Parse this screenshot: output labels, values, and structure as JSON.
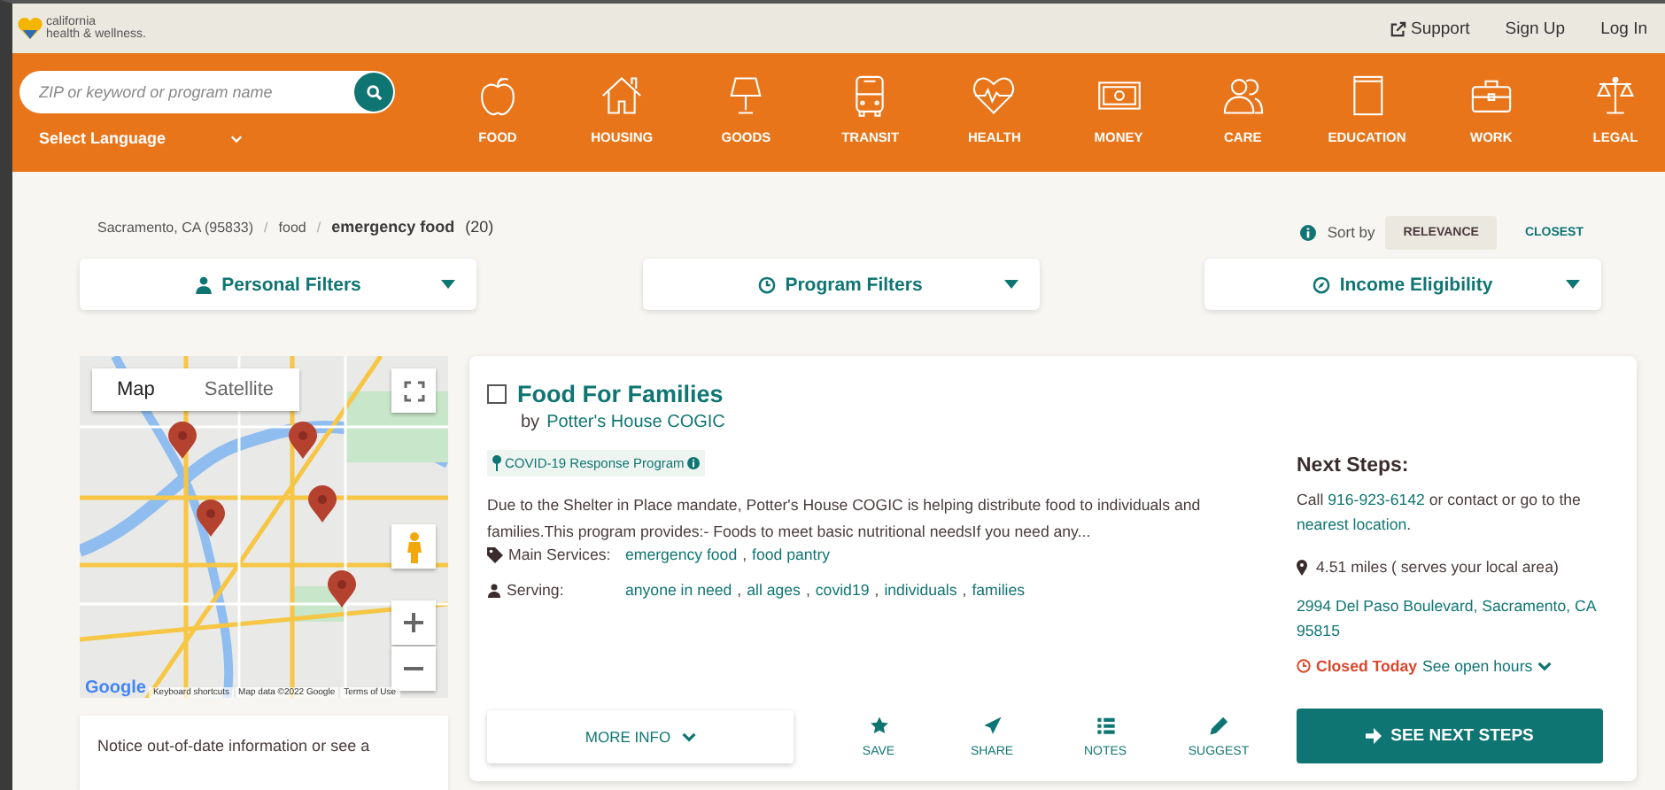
{
  "header": {
    "logo": {
      "line_1": "california",
      "line_2": "health & wellness."
    },
    "links": [
      {
        "label": "Support",
        "kind": "external"
      },
      {
        "label": "Sign Up",
        "kind": "plain"
      },
      {
        "label": "Log In",
        "kind": "plain"
      }
    ]
  },
  "search": {
    "placeholder": "ZIP or keyword or program name",
    "language": "Select Language"
  },
  "categories": [
    {
      "label": "FOOD",
      "kind": "food"
    },
    {
      "label": "HOUSING",
      "kind": "housing"
    },
    {
      "label": "GOODS",
      "kind": "goods"
    },
    {
      "label": "TRANSIT",
      "kind": "transit"
    },
    {
      "label": "HEALTH",
      "kind": "health"
    },
    {
      "label": "MONEY",
      "kind": "money"
    },
    {
      "label": "CARE",
      "kind": "care"
    },
    {
      "label": "EDUCATION",
      "kind": "education"
    },
    {
      "label": "WORK",
      "kind": "work"
    },
    {
      "label": "LEGAL",
      "kind": "legal"
    }
  ],
  "breadcrumb": {
    "separator": "/",
    "items": [
      "Sacramento, CA (95833)",
      "food"
    ],
    "current": "emergency food",
    "count": "(20)"
  },
  "sort": {
    "label": "Sort by",
    "options": [
      {
        "label": "RELEVANCE",
        "selected": true
      },
      {
        "label": "CLOSEST",
        "selected": false
      }
    ]
  },
  "filters": [
    {
      "label": "Personal Filters",
      "kind": "person"
    },
    {
      "label": "Program Filters",
      "kind": "clock"
    },
    {
      "label": "Income Eligibility",
      "kind": "compass"
    }
  ],
  "map": {
    "types": [
      {
        "label": "Map",
        "selected": true
      },
      {
        "label": "Satellite",
        "selected": false
      }
    ],
    "logo": "Google",
    "attribution": [
      "Keyboard shortcuts",
      "Map data ©2022 Google",
      "Terms of Use"
    ]
  },
  "notice": "Notice out-of-date information or see a",
  "program": {
    "checked": false,
    "title": "Food For Families",
    "by": "by",
    "provider": "Potter's House COGIC",
    "tag": "COVID-19 Response Program",
    "description": "Due to the Shelter in Place mandate, Potter's House COGIC is helping distribute food to individuals and families.This program provides:- Foods to meet basic nutritional needsIf you need any...",
    "separator": ",",
    "main_services_label": "Main Services:",
    "main_services": [
      "emergency food",
      "food pantry"
    ],
    "serving_label": "Serving:",
    "serving": [
      "anyone in need",
      "all ages",
      "covid19",
      "individuals",
      "families"
    ],
    "more_info": "MORE INFO",
    "actions": [
      {
        "label": "SAVE",
        "kind": "star"
      },
      {
        "label": "SHARE",
        "kind": "plane"
      },
      {
        "label": "NOTES",
        "kind": "list"
      },
      {
        "label": "SUGGEST",
        "kind": "pencil"
      }
    ],
    "next_steps": {
      "title": "Next Steps:",
      "call": "Call",
      "phone": "916-923-6142",
      "contact": "or contact or go to the",
      "location_link": "nearest location",
      "end": ".",
      "distance": "4.51 miles ( serves your local area)",
      "address": "2994 Del Paso Boulevard, Sacramento, CA 95815",
      "status": "Closed Today",
      "hours": "See open hours",
      "button": "SEE NEXT STEPS"
    }
  }
}
